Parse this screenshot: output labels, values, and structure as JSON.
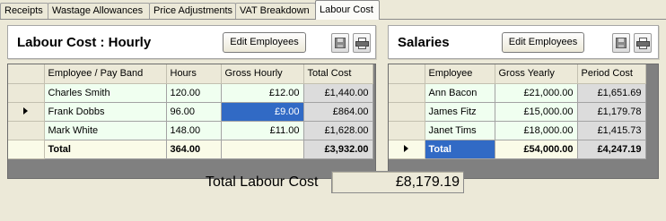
{
  "tabs": [
    {
      "label": "Receipts",
      "active": false
    },
    {
      "label": "Wastage Allowances",
      "active": false
    },
    {
      "label": "Price Adjustments",
      "active": false
    },
    {
      "label": "VAT Breakdown",
      "active": false
    },
    {
      "label": "Labour Cost",
      "active": true
    }
  ],
  "hourly": {
    "title": "Labour Cost : Hourly",
    "edit_button": "Edit Employees",
    "save_icon": "save-icon",
    "print_icon": "print-icon",
    "columns": [
      "Employee / Pay Band",
      "Hours",
      "Gross Hourly",
      "Total Cost"
    ],
    "rows": [
      {
        "name": "Charles Smith",
        "hours": "120.00",
        "gross": "£12.00",
        "total": "£1,440.00",
        "current": false
      },
      {
        "name": "Frank Dobbs",
        "hours": "96.00",
        "gross": "£9.00",
        "total": "£864.00",
        "current": true
      },
      {
        "name": "Mark White",
        "hours": "148.00",
        "gross": "£11.00",
        "total": "£1,628.00",
        "current": false
      }
    ],
    "total_row": {
      "name": "Total",
      "hours": "364.00",
      "gross": "",
      "total": "£3,932.00"
    }
  },
  "salaries": {
    "title": "Salaries",
    "edit_button": "Edit Employees",
    "save_icon": "save-icon",
    "print_icon": "print-icon",
    "columns": [
      "Employee",
      "Gross Yearly",
      "Period Cost"
    ],
    "rows": [
      {
        "name": "Ann Bacon",
        "gross": "£21,000.00",
        "period": "£1,651.69"
      },
      {
        "name": "James Fitz",
        "gross": "£15,000.00",
        "period": "£1,179.78"
      },
      {
        "name": "Janet Tims",
        "gross": "£18,000.00",
        "period": "£1,415.73"
      }
    ],
    "total_row": {
      "name": "Total",
      "gross": "£54,000.00",
      "period": "£4,247.19",
      "current": true
    }
  },
  "footer": {
    "label": "Total Labour Cost",
    "value": "£8,179.19"
  },
  "colors": {
    "selection": "#316ac5",
    "row_bg": "#f0fff0",
    "cost_bg": "#dcdcdc",
    "window_bg": "#ece9d8"
  }
}
